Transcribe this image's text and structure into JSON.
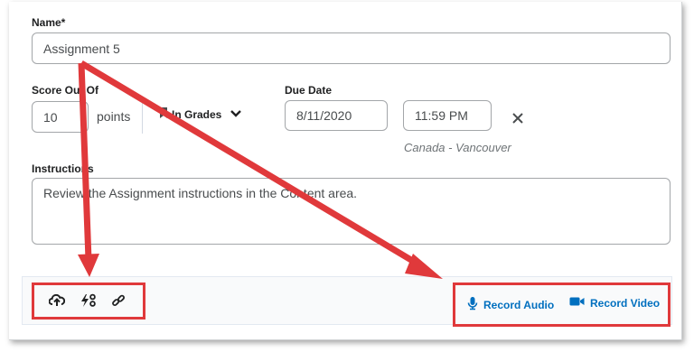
{
  "name": {
    "label": "Name*",
    "value": "Assignment 5"
  },
  "score": {
    "label": "Score Out Of",
    "value": "10",
    "unit": "points",
    "grades_label": "In Grades"
  },
  "due": {
    "label": "Due Date",
    "date": "8/11/2020",
    "time": "11:59 PM",
    "timezone": "Canada - Vancouver"
  },
  "instructions": {
    "label": "Instructions",
    "text": "Review the Assignment instructions in the Content area."
  },
  "toolbar": {
    "record_audio": "Record Audio",
    "record_video": "Record Video"
  },
  "colors": {
    "accent": "#006fbf",
    "annotation": "#e0393b"
  },
  "icons": [
    "upload-icon",
    "quicklink-icon",
    "link-icon",
    "microphone-icon",
    "video-camera-icon",
    "bookmark-icon",
    "chevron-down-icon",
    "close-icon"
  ]
}
